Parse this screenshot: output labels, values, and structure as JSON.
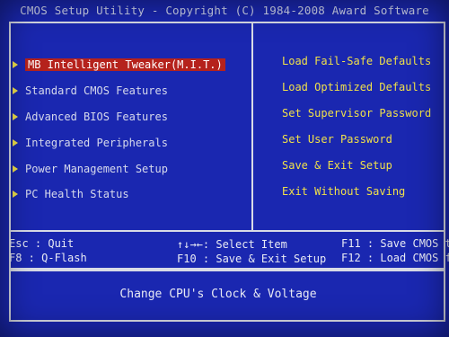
{
  "title": "CMOS Setup Utility - Copyright (C) 1984-2008 Award Software",
  "left_menu": [
    {
      "label": "MB Intelligent Tweaker(M.I.T.)",
      "selected": true
    },
    {
      "label": "Standard CMOS Features"
    },
    {
      "label": "Advanced BIOS Features"
    },
    {
      "label": "Integrated Peripherals"
    },
    {
      "label": "Power Management Setup"
    },
    {
      "label": "PC Health Status"
    }
  ],
  "right_menu": [
    {
      "label": "Load Fail-Safe Defaults"
    },
    {
      "label": "Load Optimized Defaults"
    },
    {
      "label": "Set Supervisor Password"
    },
    {
      "label": "Set User Password"
    },
    {
      "label": "Save & Exit Setup"
    },
    {
      "label": "Exit Without Saving"
    }
  ],
  "help": {
    "esc": "Esc : Quit",
    "f8": "F8  : Q-Flash",
    "select": "↑↓→←: Select Item",
    "f10": "F10 : Save & Exit Setup",
    "f11": "F11 : Save CMOS t",
    "f12": "F12 : Load CMOS f"
  },
  "status": "Change CPU's Clock & Voltage",
  "colors": {
    "background": "#1a27b0",
    "highlight": "#b5221c",
    "left_text": "#d6d9ec",
    "right_text": "#f0e04a"
  }
}
